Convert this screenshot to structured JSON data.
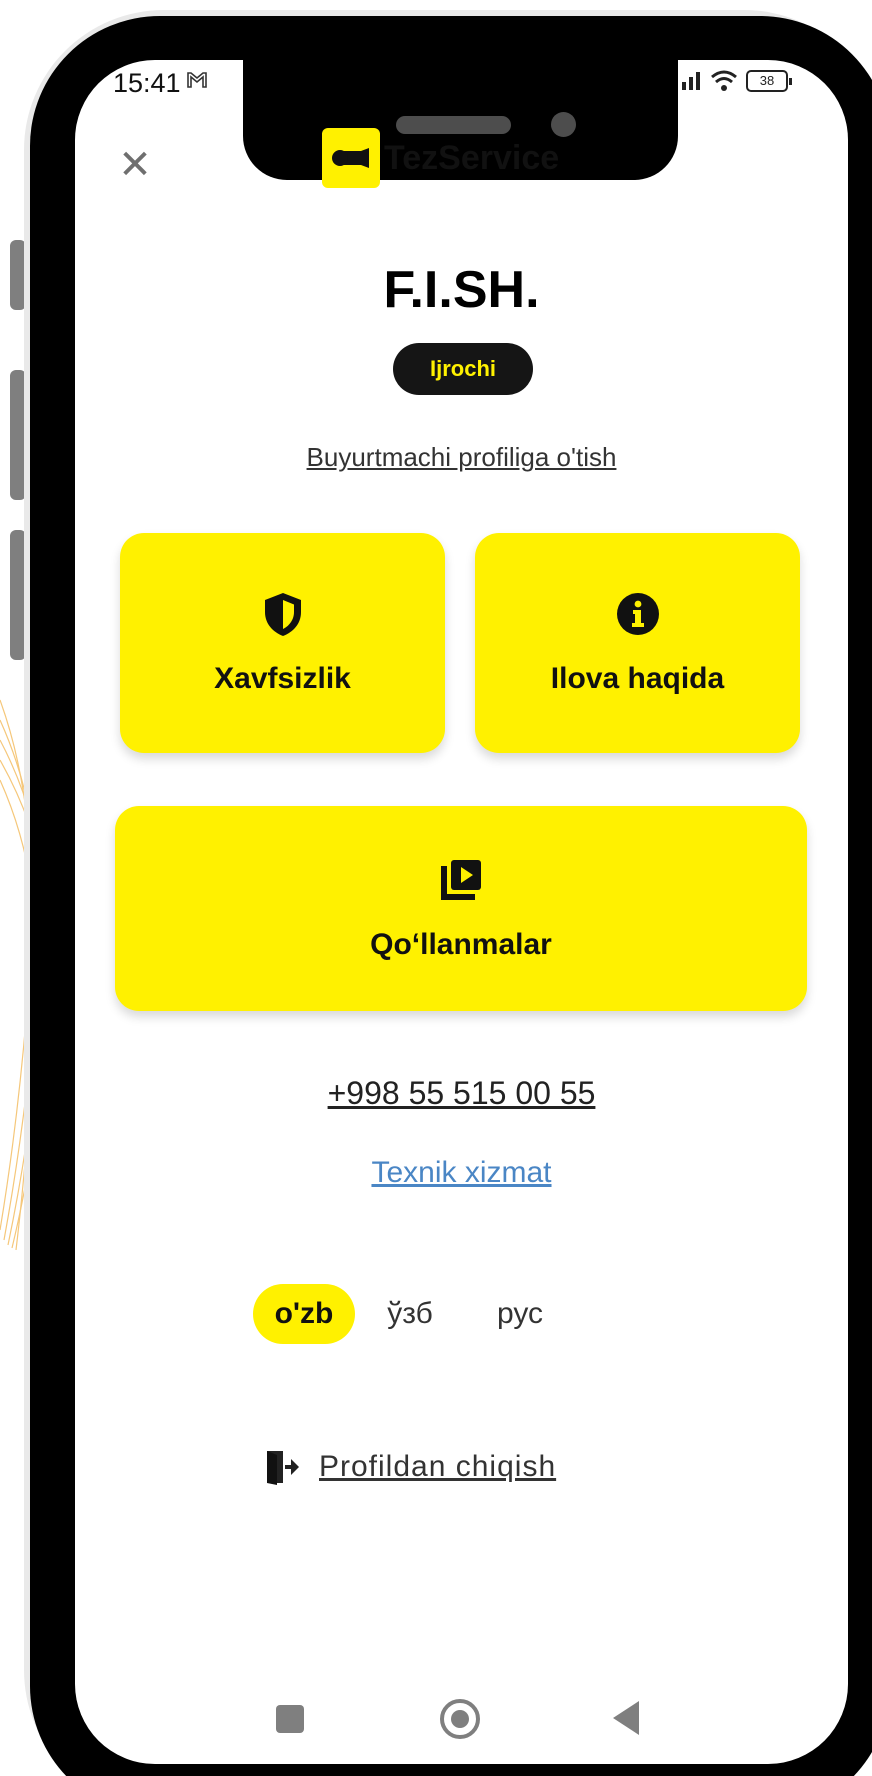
{
  "status_bar": {
    "time": "15:41",
    "mail_icon": "gmail-icon",
    "battery": "38"
  },
  "header": {
    "close_icon": "close-icon",
    "logo_text": "TezService"
  },
  "profile": {
    "name": "F.I.SH.",
    "role": "Ijrochi",
    "switch_link": "Buyurtmachi profiliga o'tish"
  },
  "cards": {
    "security": {
      "label": "Xavfsizlik",
      "icon": "shield-icon"
    },
    "about": {
      "label": "Ilova haqida",
      "icon": "info-icon"
    },
    "manuals": {
      "label": "Qo‘llanmalar",
      "icon": "video-library-icon"
    }
  },
  "contact": {
    "phone": "+998 55 515 00 55",
    "support": "Texnik xizmat"
  },
  "languages": {
    "items": [
      "o'zb",
      "ўзб",
      "рус"
    ],
    "selected": "o'zb"
  },
  "logout": {
    "label": "Profildan chiqish",
    "icon": "exit-icon"
  },
  "colors": {
    "accent": "#fff100",
    "dark": "#151515",
    "link_blue": "#4a86c5"
  }
}
